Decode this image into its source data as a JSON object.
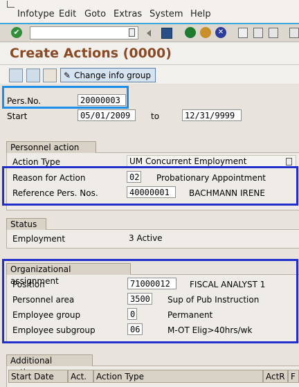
{
  "menu": [
    "Infotype",
    "Edit",
    "Goto",
    "Extras",
    "System",
    "Help"
  ],
  "title": "Create Actions (0000)",
  "app_toolbar": {
    "change_info_group": "Change info group"
  },
  "pers": {
    "label": "Pers.No.",
    "value": "20000003"
  },
  "start": {
    "label": "Start",
    "value": "05/01/2009",
    "to_label": "to",
    "to_value": "12/31/9999"
  },
  "personnel_action": {
    "title": "Personnel action",
    "action_type": {
      "label": "Action Type",
      "value": "UM Concurrent Employment"
    },
    "reason": {
      "label": "Reason for Action",
      "code": "02",
      "text": "Probationary Appointment"
    },
    "reference": {
      "label": "Reference Pers. Nos.",
      "code": "40000001",
      "text": "BACHMANN IRENE"
    }
  },
  "status": {
    "title": "Status",
    "employment": {
      "label": "Employment",
      "value": "3 Active"
    }
  },
  "org": {
    "title": "Organizational assignment",
    "position": {
      "label": "Position",
      "code": "71000012",
      "text": "FISCAL ANALYST 1"
    },
    "personnel_area": {
      "label": "Personnel area",
      "code": "3500",
      "text": "Sup of Pub Instruction"
    },
    "employee_group": {
      "label": "Employee group",
      "code": "0",
      "text": "Permanent"
    },
    "employee_subgroup": {
      "label": "Employee subgroup",
      "code": "06",
      "text": "M-OT Elig>40hrs/wk"
    }
  },
  "additional": {
    "title": "Additional actions",
    "columns": [
      "Start Date",
      "Act.",
      "Action Type",
      "ActR",
      "F"
    ]
  },
  "colors": {
    "title": "#8a4a25",
    "highlight_light": "#1a8ee8",
    "highlight_dark": "#1f2fcc"
  }
}
